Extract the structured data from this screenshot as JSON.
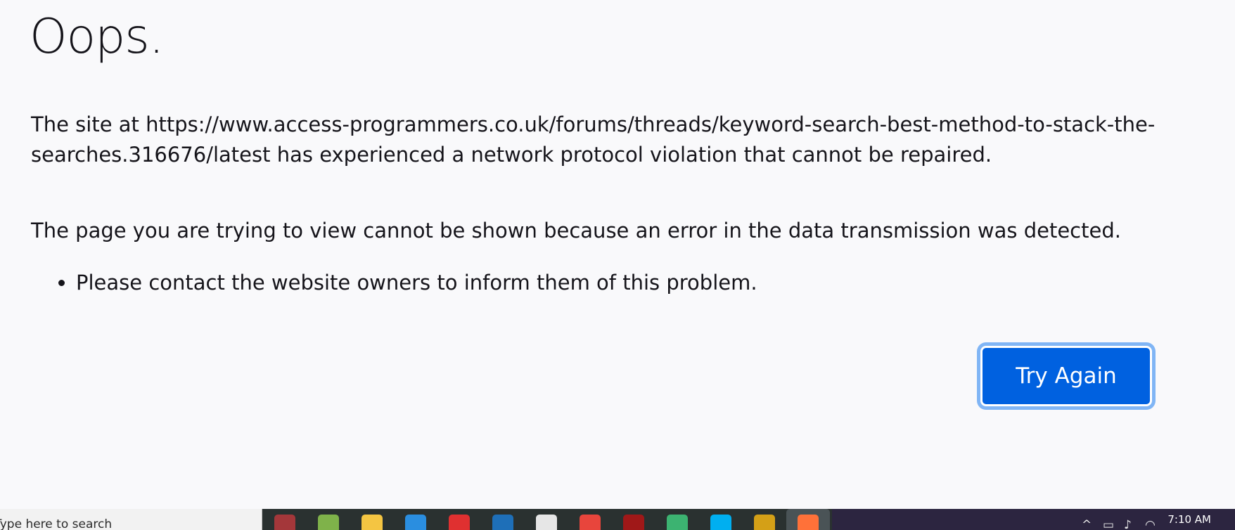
{
  "error_page": {
    "title": "Oops.",
    "message": "The site at https://www.access-programmers.co.uk/forums/threads/keyword-search-best-method-to-stack-the-searches.316676/latest has experienced a network protocol violation that cannot be repaired.",
    "detail": "The page you are trying to view cannot be shown because an error in the data transmission was detected.",
    "bullets": [
      "Please contact the website owners to inform them of this problem."
    ],
    "try_again_label": "Try Again",
    "accent_color": "#0061e0"
  },
  "taskbar": {
    "search_placeholder": "Type here to search",
    "apps": [
      {
        "icon": "microsoft-access-icon",
        "color": "#a4373a"
      },
      {
        "icon": "notepad-icon",
        "color": "#7fb24a"
      },
      {
        "icon": "file-explorer-icon",
        "color": "#f4c542"
      },
      {
        "icon": "internet-explorer-icon",
        "color": "#2a8ee0"
      },
      {
        "icon": "yandex-icon",
        "color": "#e03030"
      },
      {
        "icon": "app-c-icon",
        "color": "#1e6fb8"
      },
      {
        "icon": "inkscape-icon",
        "color": "#e6e6e6"
      },
      {
        "icon": "chrome-icon",
        "color": "#e8453c"
      },
      {
        "icon": "app-red-icon",
        "color": "#a01818"
      },
      {
        "icon": "app-n-icon",
        "color": "#3cb371"
      },
      {
        "icon": "skype-icon",
        "color": "#00aff0"
      },
      {
        "icon": "app-gift-icon",
        "color": "#d4a017"
      },
      {
        "icon": "firefox-icon",
        "color": "#ff7139"
      }
    ],
    "clock": "7:10 AM"
  }
}
